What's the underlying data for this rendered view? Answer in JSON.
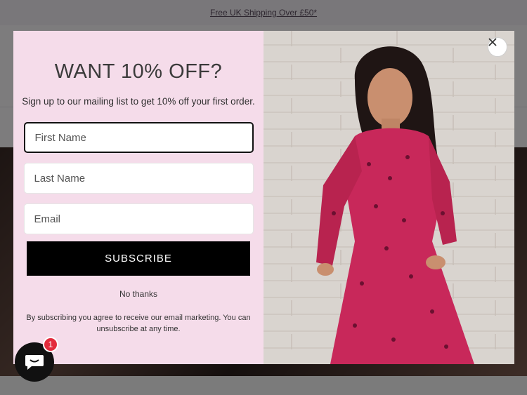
{
  "announcement": {
    "text": "Free UK Shipping Over £50*"
  },
  "popup": {
    "headline": "WANT 10% OFF?",
    "subhead": "Sign up to our mailing list to get 10% off your first order.",
    "fields": {
      "first_name_placeholder": "First Name",
      "last_name_placeholder": "Last Name",
      "email_placeholder": "Email"
    },
    "subscribe_label": "SUBSCRIBE",
    "no_thanks_label": "No thanks",
    "disclaimer": "By subscribing you agree to receive our email marketing. You can unsubscribe at any time.",
    "close_icon": "close-icon"
  },
  "chat": {
    "icon": "chat-icon",
    "badge_count": "1"
  },
  "colors": {
    "popup_bg": "#f5dcea",
    "button_bg": "#000000",
    "badge": "#e32b3c"
  }
}
